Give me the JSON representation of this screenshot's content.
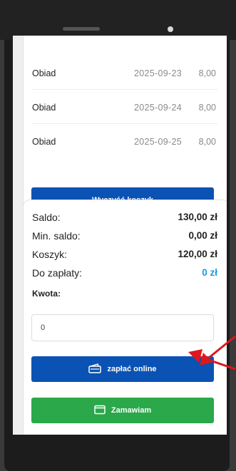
{
  "orders": [
    {
      "name": "Obiad",
      "date": "2025-09-23",
      "amount": "8,00"
    },
    {
      "name": "Obiad",
      "date": "2025-09-24",
      "amount": "8,00"
    },
    {
      "name": "Obiad",
      "date": "2025-09-25",
      "amount": "8,00"
    }
  ],
  "cart": {
    "clear_label": "Wyczyść koszyk"
  },
  "summary": {
    "saldo_label": "Saldo:",
    "saldo_value": "130,00 zł",
    "min_saldo_label": "Min. saldo:",
    "min_saldo_value": "0,00 zł",
    "koszyk_label": "Koszyk:",
    "koszyk_value": "120,00 zł",
    "do_zaplaty_label": "Do zapłaty:",
    "do_zaplaty_value": "0 zł"
  },
  "payment": {
    "kwota_label": "Kwota:",
    "kwota_value": "0",
    "pay_online_label": "zapłać online",
    "order_label": "Zamawiam"
  },
  "colors": {
    "primary": "#0a52b4",
    "success": "#2aa84a",
    "accent": "#1a9be0",
    "annotation": "#e0161b"
  }
}
